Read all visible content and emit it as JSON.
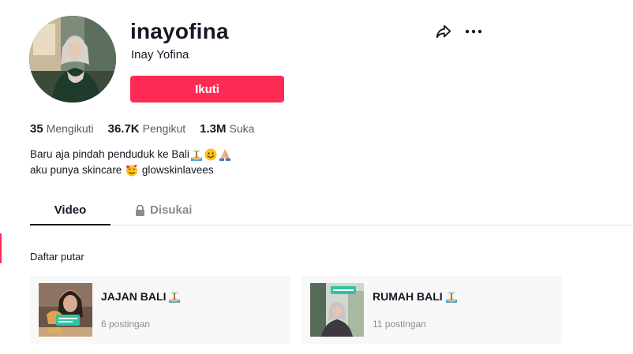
{
  "profile": {
    "username": "inayofina",
    "display_name": "Inay Yofina",
    "follow_label": "Ikuti"
  },
  "stats": [
    {
      "value": "35",
      "label": "Mengikuti"
    },
    {
      "value": "36.7K",
      "label": "Pengikut"
    },
    {
      "value": "1.3M",
      "label": "Suka"
    }
  ],
  "bio": {
    "line1_text": "Baru aja pindah penduduk ke Bali",
    "line1_emojis": [
      "palm-island-emoji",
      "smiling-face-emoji",
      "praying-hands-emoji"
    ],
    "line2_before": "aku punya skincare ",
    "line2_emoji": "smiling-hearts-emoji",
    "line2_after": " glowskinlavees"
  },
  "tabs": {
    "video": "Video",
    "liked": "Disukai"
  },
  "playlists_section": {
    "title": "Daftar putar",
    "items": [
      {
        "title": "JAJAN BALI",
        "count": "6 postingan"
      },
      {
        "title": "RUMAH BALI",
        "count": "11 postingan"
      }
    ]
  },
  "colors": {
    "accent": "#fe2c55",
    "text_primary": "#161823",
    "text_secondary": "#8a8b91",
    "card_bg": "#f8f8f8"
  },
  "icons": [
    "share-icon",
    "more-options-icon",
    "lock-icon"
  ]
}
